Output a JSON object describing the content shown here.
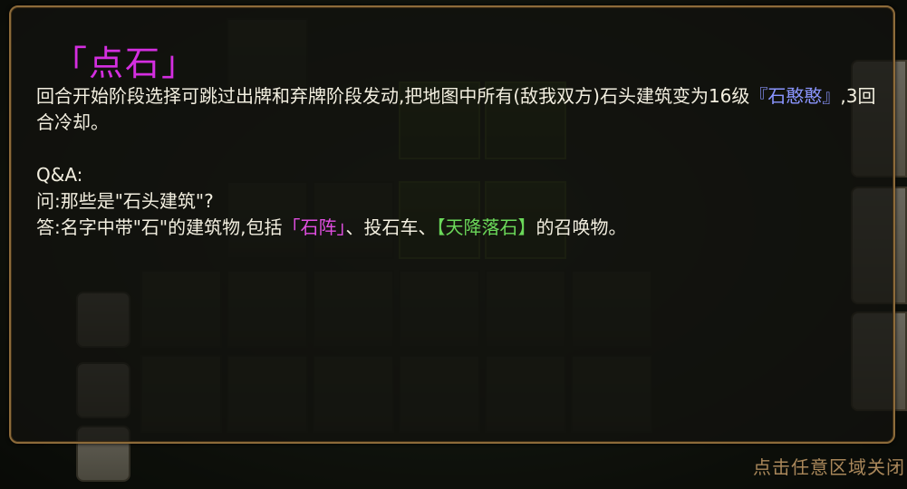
{
  "tooltip": {
    "title": "「点石」",
    "description_prefix": "回合开始阶段选择可跳过出牌和弃牌阶段发动,把地图中所有(敌我双方)石头建筑变为16级",
    "description_link": "『石憨憨』",
    "description_suffix": ",3回合冷却。",
    "qa_header": "Q&A:",
    "question": "问:那些是\"石头建筑\"?",
    "answer_prefix": "答:名字中带\"石\"的建筑物,包括",
    "answer_link_1": "「石阵」",
    "answer_mid": "、投石车、",
    "answer_link_2": "【天降落石】",
    "answer_suffix": "的召唤物。"
  },
  "close_hint": "点击任意区域关闭",
  "colors": {
    "title": "#d42ee0",
    "body_text": "#f3efe0",
    "link_blue": "#8a95ff",
    "link_pink": "#e04ee0",
    "link_green": "#6bd85a",
    "close_hint": "#a9875a",
    "panel_border": "#8d6b3a"
  }
}
